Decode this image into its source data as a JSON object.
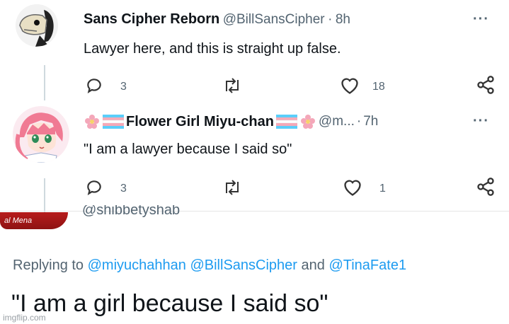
{
  "tweet1": {
    "display_name": "Sans Cipher Reborn",
    "handle": "@BillSansCipher",
    "separator": "·",
    "time": "8h",
    "text": "Lawyer here, and this is straight up false.",
    "reply_count": "3",
    "like_count": "18",
    "more": "···"
  },
  "tweet2": {
    "display_name": "Flower Girl Miyu-chan",
    "handle": "@m...",
    "separator": "·",
    "time": "7h",
    "text": "\"I am a lawyer because I said so\"",
    "reply_count": "3",
    "like_count": "1",
    "more": "···"
  },
  "tweet3": {
    "handle_partial": "@shibbetyshab",
    "avatar_text": "al Mena",
    "replying_prefix": "Replying to",
    "mention1": "@miyuchahhan",
    "mention2": "@BillSansCipher",
    "and_word": "and",
    "mention3": "@TinaFate1",
    "text": "\"I am a girl because I said so\""
  },
  "watermark": "imgflip.com",
  "colors": {
    "text": "#0f1419",
    "muted": "#536471",
    "mention": "#1d9bf0",
    "trans_blue": "#5bcefa",
    "trans_pink": "#f5a9b8"
  },
  "icons": [
    "reply-icon",
    "retweet-icon",
    "like-icon",
    "share-icon",
    "flower-icon",
    "trans-flag-icon"
  ]
}
